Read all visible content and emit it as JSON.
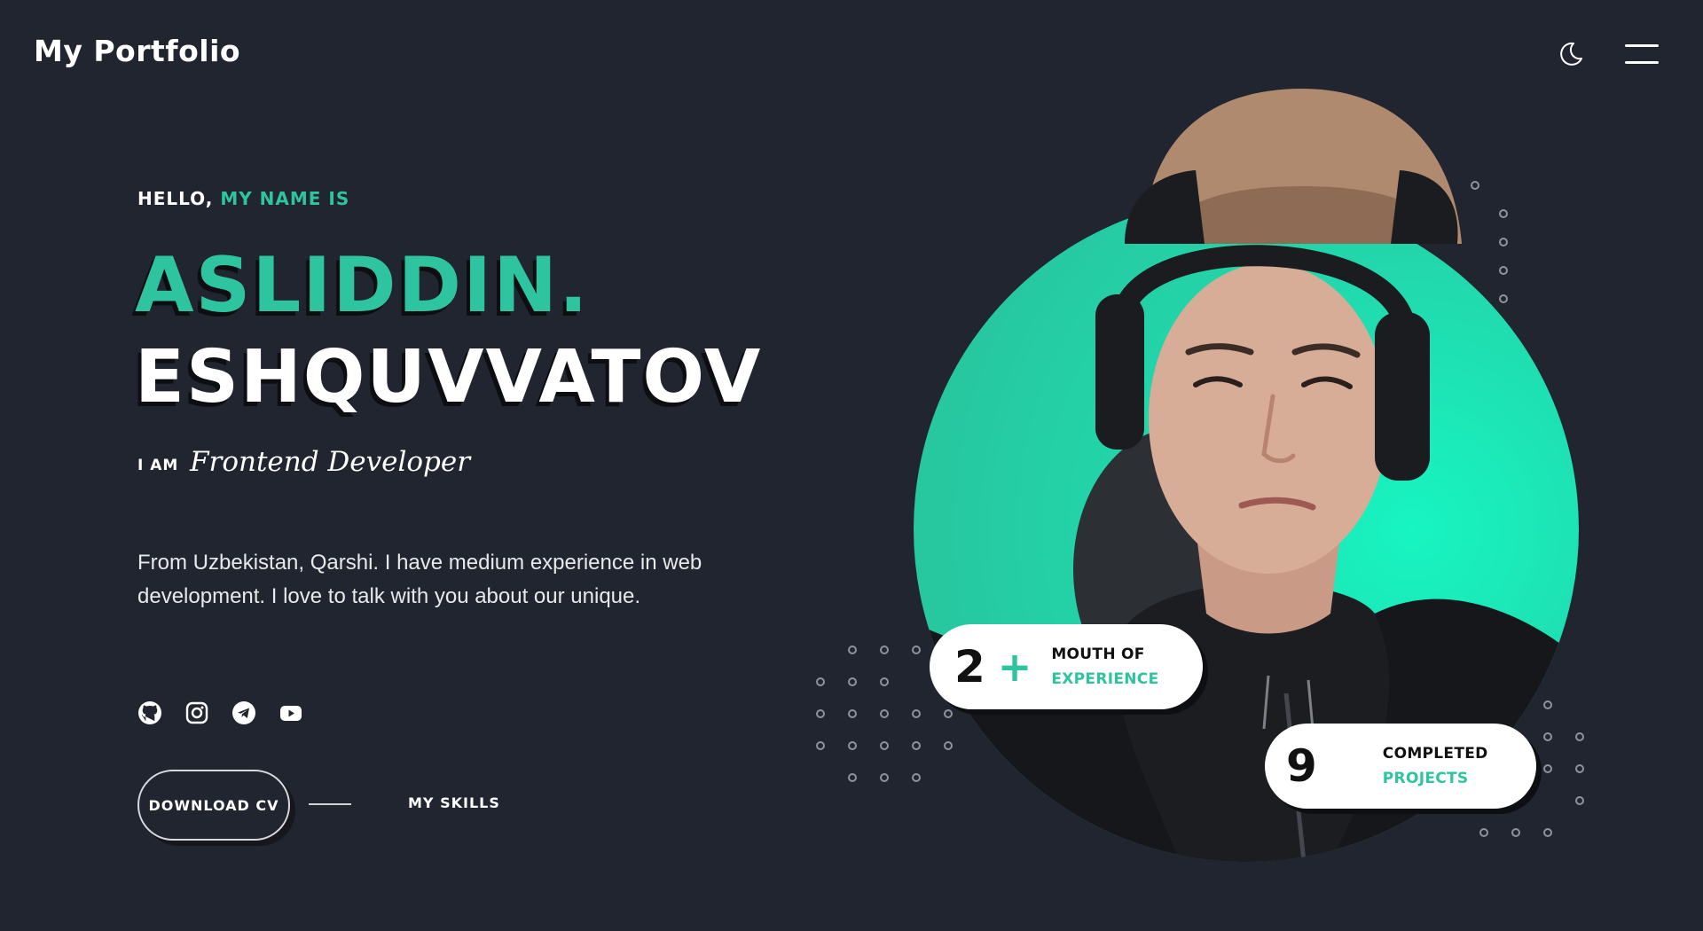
{
  "header": {
    "logo": "My Portfolio",
    "theme_toggle_icon": "moon-icon",
    "menu_icon": "hamburger-menu-icon"
  },
  "hero": {
    "greeting_prefix": "HELLO,",
    "greeting_accent": "MY NAME IS",
    "first_name": "ASLIDDIN.",
    "last_name": "ESHQUVVATOV",
    "iam_label": "I AM",
    "role": "Frontend Developer",
    "description": "From Uzbekistan, Qarshi. I have medium experience in web development. I love to talk with you about our unique.",
    "socials": [
      {
        "icon": "github-icon"
      },
      {
        "icon": "instagram-icon"
      },
      {
        "icon": "telegram-icon"
      },
      {
        "icon": "youtube-icon"
      }
    ],
    "download_label": "DOWNLOAD CV",
    "skills_label": "MY SKILLS"
  },
  "stats": {
    "experience": {
      "number": "2",
      "plus": "+",
      "line1": "MOUTH OF",
      "line2": "EXPERIENCE"
    },
    "projects": {
      "number": "9",
      "line1": "COMPLETED",
      "line2": "PROJECTS"
    }
  },
  "colors": {
    "background": "#21252f",
    "accent": "#2ec4a0",
    "circle": "#1ef0bd",
    "text": "#ffffff"
  }
}
